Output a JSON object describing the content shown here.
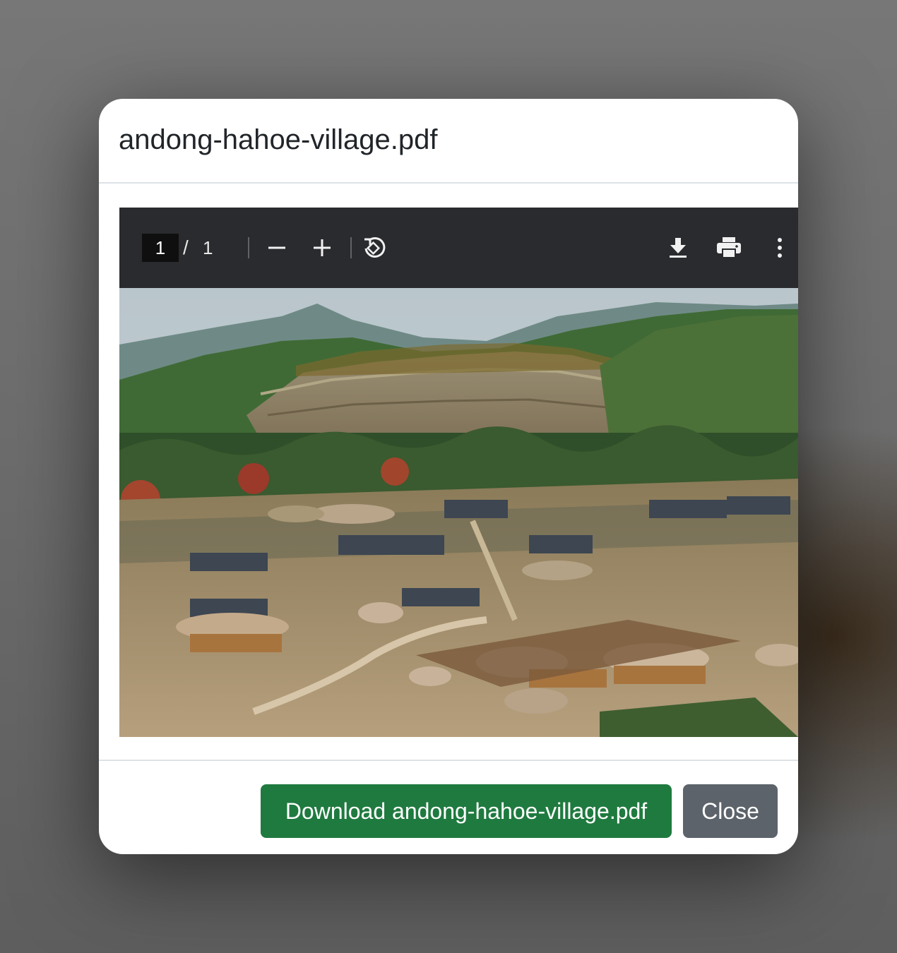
{
  "modal": {
    "title": "andong-hahoe-village.pdf"
  },
  "pdf_viewer": {
    "toolbar": {
      "current_page": "1",
      "page_separator": "/",
      "total_pages": "1",
      "icons": [
        "zoom-out-icon",
        "zoom-in-icon",
        "rotate-icon",
        "download-icon",
        "print-icon",
        "more-options-icon"
      ]
    },
    "page_image": {
      "description_icon": "village-landscape-image"
    }
  },
  "footer": {
    "download_label": "Download andong-hahoe-village.pdf",
    "close_label": "Close"
  },
  "colors": {
    "toolbar_bg": "#292b2e",
    "download_button": "#1f7a3f",
    "close_button": "#5c636a"
  }
}
